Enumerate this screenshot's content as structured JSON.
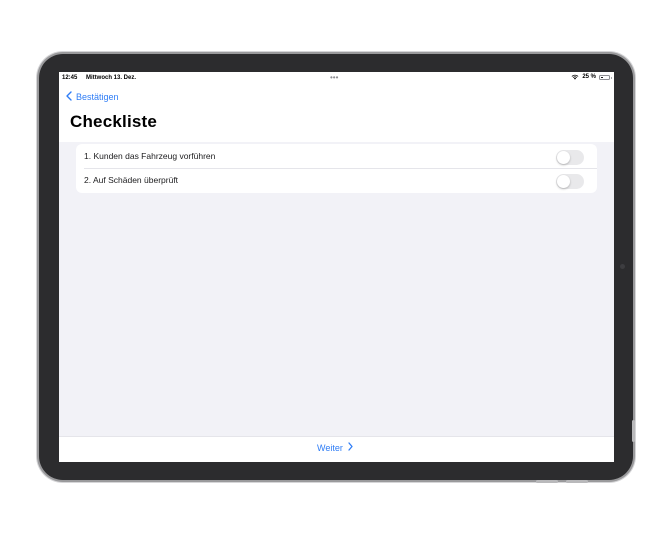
{
  "status_bar": {
    "time": "12:45",
    "date": "Mittwoch 13. Dez.",
    "battery": "25 %",
    "battery_level": 0.25
  },
  "nav": {
    "back_label": "Bestätigen",
    "title": "Checkliste"
  },
  "checklist": {
    "items": [
      {
        "label": "1. Kunden das Fahrzeug vorführen",
        "checked": false
      },
      {
        "label": "2. Auf Schäden überprüft",
        "checked": false
      }
    ]
  },
  "toolbar": {
    "next_label": "Weiter"
  },
  "colors": {
    "accent": "#2f7df6",
    "background": "#f2f2f7"
  }
}
